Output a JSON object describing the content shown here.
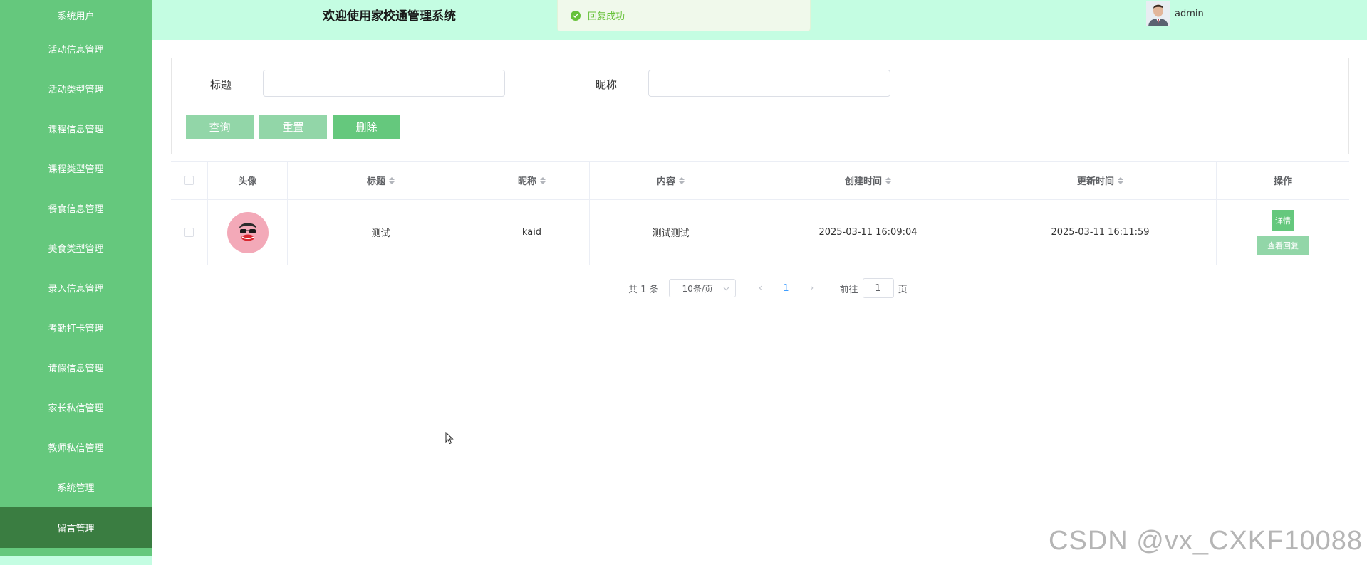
{
  "sidebar": {
    "items": [
      {
        "label": "系统用户"
      },
      {
        "label": "活动信息管理"
      },
      {
        "label": "活动类型管理"
      },
      {
        "label": "课程信息管理"
      },
      {
        "label": "课程类型管理"
      },
      {
        "label": "餐食信息管理"
      },
      {
        "label": "美食类型管理"
      },
      {
        "label": "录入信息管理"
      },
      {
        "label": "考勤打卡管理"
      },
      {
        "label": "请假信息管理"
      },
      {
        "label": "家长私信管理"
      },
      {
        "label": "教师私信管理"
      },
      {
        "label": "系统管理"
      },
      {
        "label": "留言管理",
        "active": true
      }
    ]
  },
  "header": {
    "title": "欢迎使用家校通管理系统",
    "username": "admin",
    "avatar_icon": "user-photo-icon"
  },
  "toast": {
    "message": "回复成功",
    "icon": "success-check-icon",
    "color": "#67c23a"
  },
  "search": {
    "title_label": "标题",
    "title_value": "",
    "nickname_label": "昵称",
    "nickname_value": "",
    "query_label": "查询",
    "reset_label": "重置",
    "delete_label": "删除"
  },
  "table": {
    "headers": {
      "avatar": "头像",
      "title": "标题",
      "nickname": "昵称",
      "content": "内容",
      "created": "创建时间",
      "updated": "更新时间",
      "actions": "操作"
    },
    "rows": [
      {
        "title": "测试",
        "nickname": "kaid",
        "content": "测试测试",
        "created": "2025-03-11 16:09:04",
        "updated": "2025-03-11 16:11:59",
        "detail_label": "详情",
        "view_reply_label": "查看回复"
      }
    ]
  },
  "pagination": {
    "total_text": "共 1 条",
    "page_size": "10条/页",
    "current_page": "1",
    "goto_prefix": "前往",
    "goto_value": "1",
    "goto_suffix": "页"
  },
  "watermark": "CSDN @vx_CXKF10088",
  "colors": {
    "sidebar": "#65c87d",
    "sidebar_active": "#3a7d41",
    "header": "#c4fde2",
    "primary_button": "#65c87d",
    "muted_button": "#92d6a8"
  }
}
